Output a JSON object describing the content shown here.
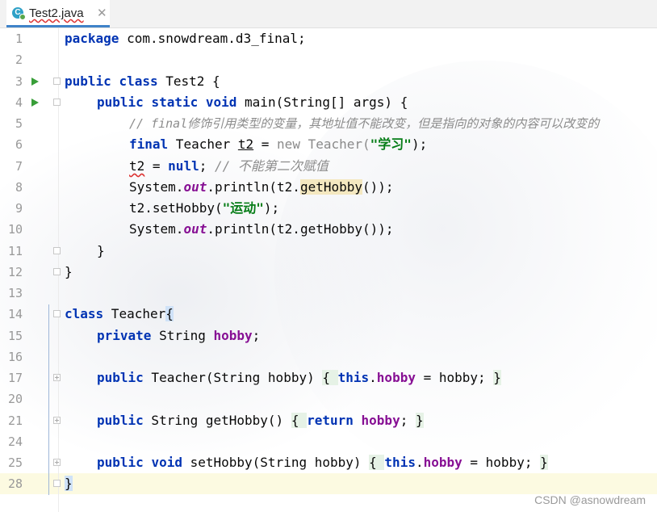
{
  "tab": {
    "filename": "Test2.java",
    "file_icon": "java-class-icon",
    "close": "✕"
  },
  "line_numbers": [
    "1",
    "2",
    "3",
    "4",
    "5",
    "6",
    "7",
    "8",
    "9",
    "10",
    "11",
    "12",
    "13",
    "14",
    "15",
    "16",
    "17",
    "20",
    "21",
    "24",
    "25",
    "28"
  ],
  "code": {
    "l1": {
      "kw": "package",
      "rest": " com.snowdream.d3_final;"
    },
    "l3": {
      "kw1": "public",
      "kw2": "class",
      "rest": " Test2 {"
    },
    "l4": {
      "kw1": "public",
      "kw2": "static",
      "kw3": "void",
      "rest": " main(String[] args) {"
    },
    "l5": {
      "comment": "// final修饰引用类型的变量，其地址值不能改变，但是指向的对象的内容可以改变的"
    },
    "l6": {
      "kw": "final",
      "type": " Teacher ",
      "var": "t2",
      "eq": " = ",
      "kw_new": "new",
      "ctor": " Teacher(",
      "str": "\"学习\"",
      "end": ");"
    },
    "l7": {
      "var": "t2",
      "eq": " = ",
      "kw_null": "null",
      "semi": ";",
      "comment": " // 不能第二次赋值"
    },
    "l8": {
      "a": "System.",
      "out": "out",
      "b": ".println(t2.",
      "call": "getHobby",
      "c": "());"
    },
    "l9": {
      "a": "t2.setHobby(",
      "str": "\"运动\"",
      "b": ");"
    },
    "l10": {
      "a": "System.",
      "out": "out",
      "b": ".println(t2.getHobby());"
    },
    "l11": {
      "text": "}"
    },
    "l12": {
      "text": "}"
    },
    "l14": {
      "kw": "class",
      "rest": " Teacher",
      "brace": "{"
    },
    "l15": {
      "kw": "private",
      "type": " String ",
      "field": "hobby",
      "end": ";"
    },
    "l17": {
      "kw": "public",
      "a": " Teacher(String hobby) ",
      "open": "{ ",
      "kw_this": "this",
      "dot": ".",
      "field": "hobby",
      "b": " = hobby; ",
      "close": "}"
    },
    "l21": {
      "kw": "public",
      "a": " String getHobby() ",
      "open": "{ ",
      "kw_ret": "return",
      "sp": " ",
      "field": "hobby",
      "b": "; ",
      "close": "}"
    },
    "l25": {
      "kw1": "public",
      "kw2": "void",
      "a": " setHobby(String hobby) ",
      "open": "{ ",
      "kw_this": "this",
      "dot": ".",
      "field": "hobby",
      "b": " = hobby; ",
      "close": "}"
    },
    "l28": {
      "brace": "}"
    }
  },
  "watermark": "CSDN @asnowdream",
  "colors": {
    "keyword": "#0033b3",
    "string": "#067d17",
    "comment": "#8c8c8c",
    "field": "#871094",
    "run_icon": "#389e38",
    "tab_underline": "#4083c9"
  }
}
